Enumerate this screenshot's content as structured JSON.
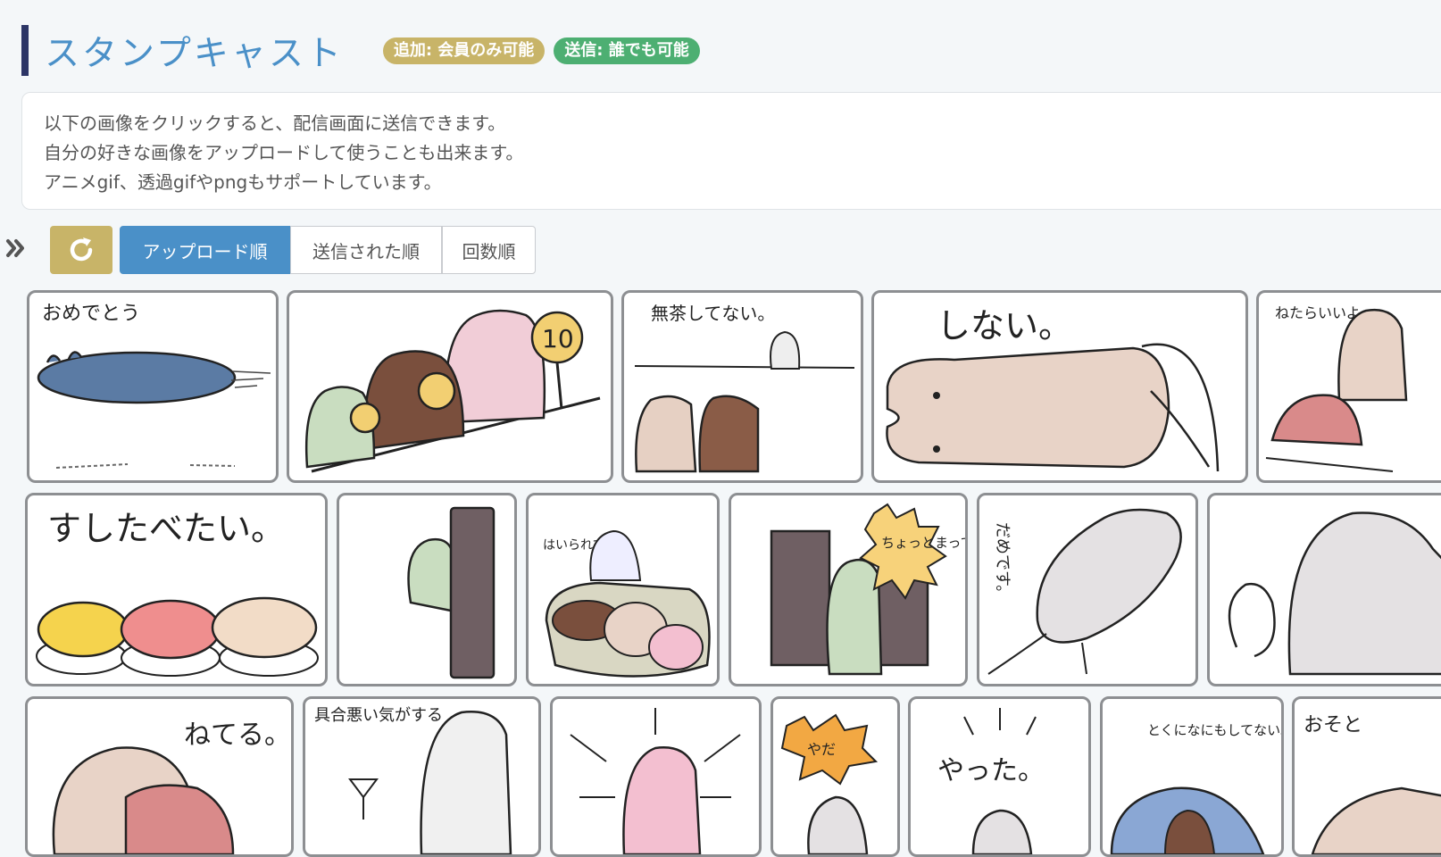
{
  "header": {
    "title": "スタンプキャスト",
    "badge_add": "追加: 会員のみ可能",
    "badge_send": "送信: 誰でも可能"
  },
  "info": {
    "line1": "以下の画像をクリックすると、配信画面に送信できます。",
    "line2": "自分の好きな画像をアップロードして使うことも出来ます。",
    "line3": "アニメgif、透過gifやpngもサポートしています。"
  },
  "toolbar": {
    "expand_icon": "double-chevron-right-icon",
    "reload_icon": "reload-icon",
    "sort": {
      "upload": "アップロード順",
      "sent": "送信された順",
      "count": "回数順"
    },
    "active_sort": "upload"
  },
  "stamps": {
    "s1": "おめでとう",
    "s2_sign": "10",
    "s3": "無茶してない。",
    "s4": "しない。",
    "s5": "ねたらいいよ",
    "s6": "すしたべたい。",
    "s8": "はいられてた",
    "s9": "ちょっとまって",
    "s10": "だめです。",
    "s12": "ねてる。",
    "s13": "具合悪い気がする",
    "s15": "やだ",
    "s16": "やった。",
    "s17": "とくになにもしてない。",
    "s18": "おそと"
  },
  "colors": {
    "accent_blue": "#4a90c8",
    "gold": "#c8b468",
    "green": "#4daf72",
    "header_bar": "#2c3566"
  }
}
